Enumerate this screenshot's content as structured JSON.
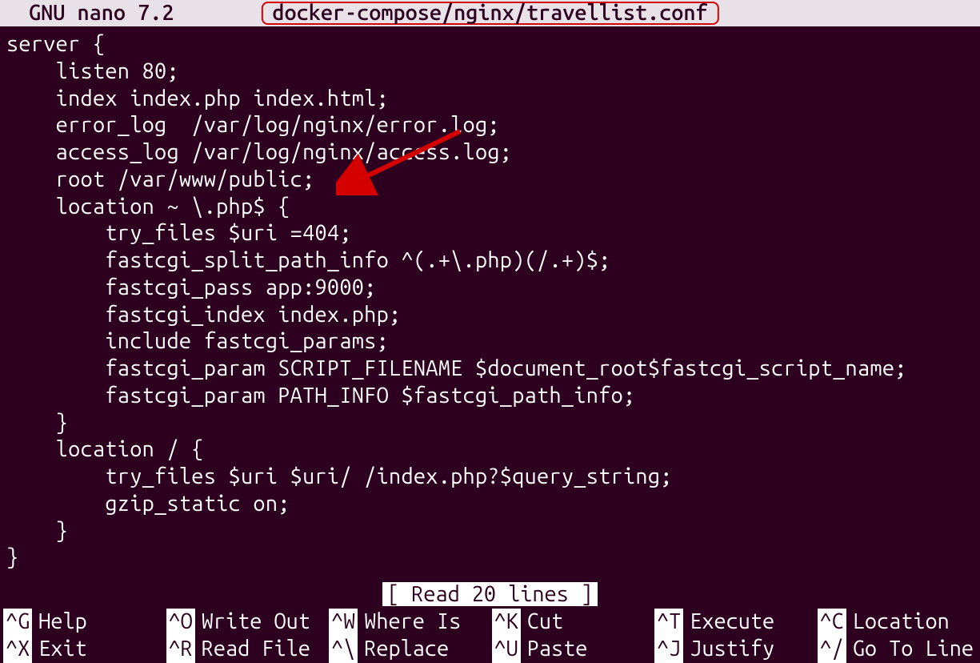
{
  "titlebar": {
    "app": "GNU nano 7.2",
    "file": "docker-compose/nginx/travellist.conf"
  },
  "editor": {
    "lines": [
      "server {",
      "    listen 80;",
      "    index index.php index.html;",
      "    error_log  /var/log/nginx/error.log;",
      "    access_log /var/log/nginx/access.log;",
      "    root /var/www/public;",
      "    location ~ \\.php$ {",
      "        try_files $uri =404;",
      "        fastcgi_split_path_info ^(.+\\.php)(/.+)$;",
      "        fastcgi_pass app:9000;",
      "        fastcgi_index index.php;",
      "        include fastcgi_params;",
      "        fastcgi_param SCRIPT_FILENAME $document_root$fastcgi_script_name;",
      "        fastcgi_param PATH_INFO $fastcgi_path_info;",
      "    }",
      "    location / {",
      "        try_files $uri $uri/ /index.php?$query_string;",
      "        gzip_static on;",
      "    }",
      "}"
    ]
  },
  "status": "[ Read 20 lines ]",
  "help": [
    {
      "key": "^G",
      "label": "Help"
    },
    {
      "key": "^O",
      "label": "Write Out"
    },
    {
      "key": "^W",
      "label": "Where Is"
    },
    {
      "key": "^K",
      "label": "Cut"
    },
    {
      "key": "^T",
      "label": "Execute"
    },
    {
      "key": "^C",
      "label": "Location"
    },
    {
      "key": "^X",
      "label": "Exit"
    },
    {
      "key": "^R",
      "label": "Read File"
    },
    {
      "key": "^\\",
      "label": "Replace"
    },
    {
      "key": "^U",
      "label": "Paste"
    },
    {
      "key": "^J",
      "label": "Justify"
    },
    {
      "key": "^/",
      "label": "Go To Line"
    }
  ]
}
